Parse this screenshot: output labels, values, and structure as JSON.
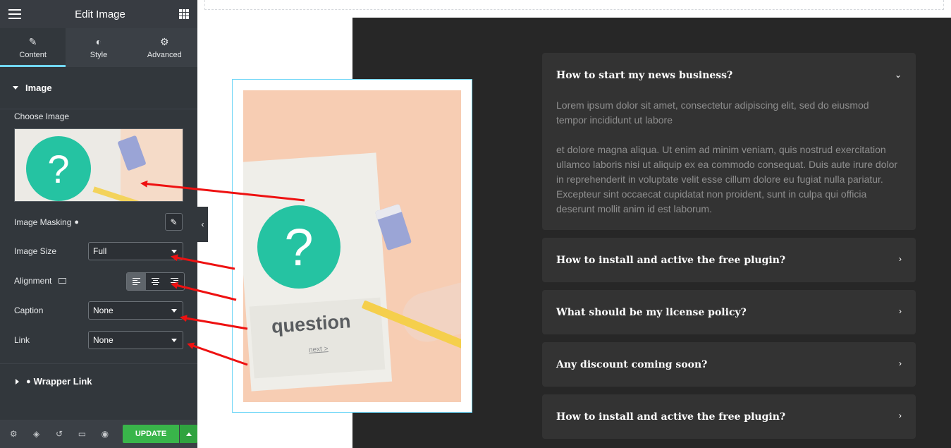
{
  "panel": {
    "header_title": "Edit Image",
    "tabs": [
      {
        "label": "Content",
        "icon": "pencil-icon",
        "active": true
      },
      {
        "label": "Style",
        "icon": "half-circle-icon",
        "active": false
      },
      {
        "label": "Advanced",
        "icon": "gear-icon",
        "active": false
      }
    ],
    "section_title": "Image",
    "choose_image_label": "Choose Image",
    "image_masking_label": "Image Masking",
    "image_size_label": "Image Size",
    "image_size_value": "Full",
    "alignment_label": "Alignment",
    "caption_label": "Caption",
    "caption_value": "None",
    "link_label": "Link",
    "link_value": "None",
    "wrapper_link_label": "Wrapper Link",
    "update_label": "UPDATE"
  },
  "canvas": {
    "image_word": "question",
    "image_next": "next >",
    "image_question_mark": "?"
  },
  "faq": [
    {
      "question": "How to start my news business?",
      "expanded": true,
      "answer": [
        "Lorem ipsum dolor sit amet, consectetur adipiscing elit, sed do eiusmod tempor incididunt ut labore",
        "et dolore magna aliqua. Ut enim ad minim veniam, quis nostrud exercitation ullamco laboris nisi ut aliquip ex ea commodo consequat. Duis aute irure dolor in reprehenderit in voluptate velit esse cillum dolore eu fugiat nulla pariatur. Excepteur sint occaecat cupidatat non proident, sunt in culpa qui officia deserunt mollit anim id est laborum."
      ]
    },
    {
      "question": "How to install and active the free plugin?",
      "expanded": false
    },
    {
      "question": "What should be my license policy?",
      "expanded": false
    },
    {
      "question": "Any discount coming soon?",
      "expanded": false
    },
    {
      "question": "How to install and active the free plugin?",
      "expanded": false
    }
  ],
  "colors": {
    "panel_bg": "#32373c",
    "accent_tab": "#71d7f7",
    "update_green": "#39b54a",
    "teal_circle": "#25c3a2",
    "annotation_arrow": "#ee1111",
    "faq_item_bg": "#333333",
    "canvas_dark": "#272727"
  }
}
